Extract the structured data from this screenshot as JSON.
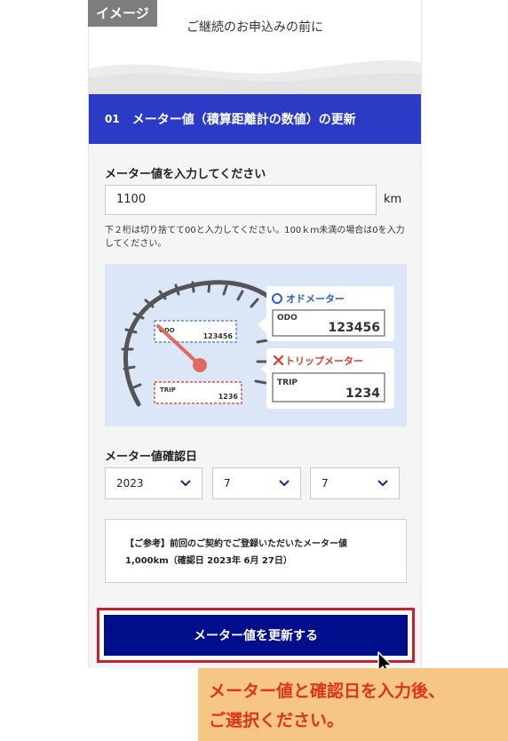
{
  "tag": "イメージ",
  "header": {
    "title": "ご継続のお申込みの前に"
  },
  "section": {
    "number": "01",
    "title": "メーター値（積算距離計の数値）の更新"
  },
  "meter": {
    "label": "メーター値を入力してください",
    "value": "1100",
    "unit": "km",
    "note": "下２桁は切り捨てて00と入力してください。100ｋｍ未満の場合は0を入力してください。"
  },
  "illustration": {
    "gauge_odo_label": "ODO",
    "gauge_odo_value": "123456",
    "gauge_trip_label": "TRIP",
    "gauge_trip_value": "1236",
    "odo_card_title": "オドメーター",
    "odo_card_label": "ODO",
    "odo_card_value": "123456",
    "trip_card_title": "トリップメーター",
    "trip_card_label": "TRIP",
    "trip_card_value": "1234",
    "colors": {
      "bg": "#dbe7f6",
      "ok": "#2a63c4",
      "ng": "#d93a32",
      "needle": "#e06a5f"
    }
  },
  "date": {
    "label": "メーター値確認日",
    "year": "2023",
    "month": "7",
    "day": "7"
  },
  "reference": {
    "line1": "【ご参考】前回のご契約でご登録いただいたメーター値",
    "line2": "1,000km（確認日 2023年 6月 27日）"
  },
  "submit_label": "メーター値を更新する",
  "callout": {
    "line1": "メーター値と確認日を入力後、",
    "line2": "ご選択ください。"
  }
}
